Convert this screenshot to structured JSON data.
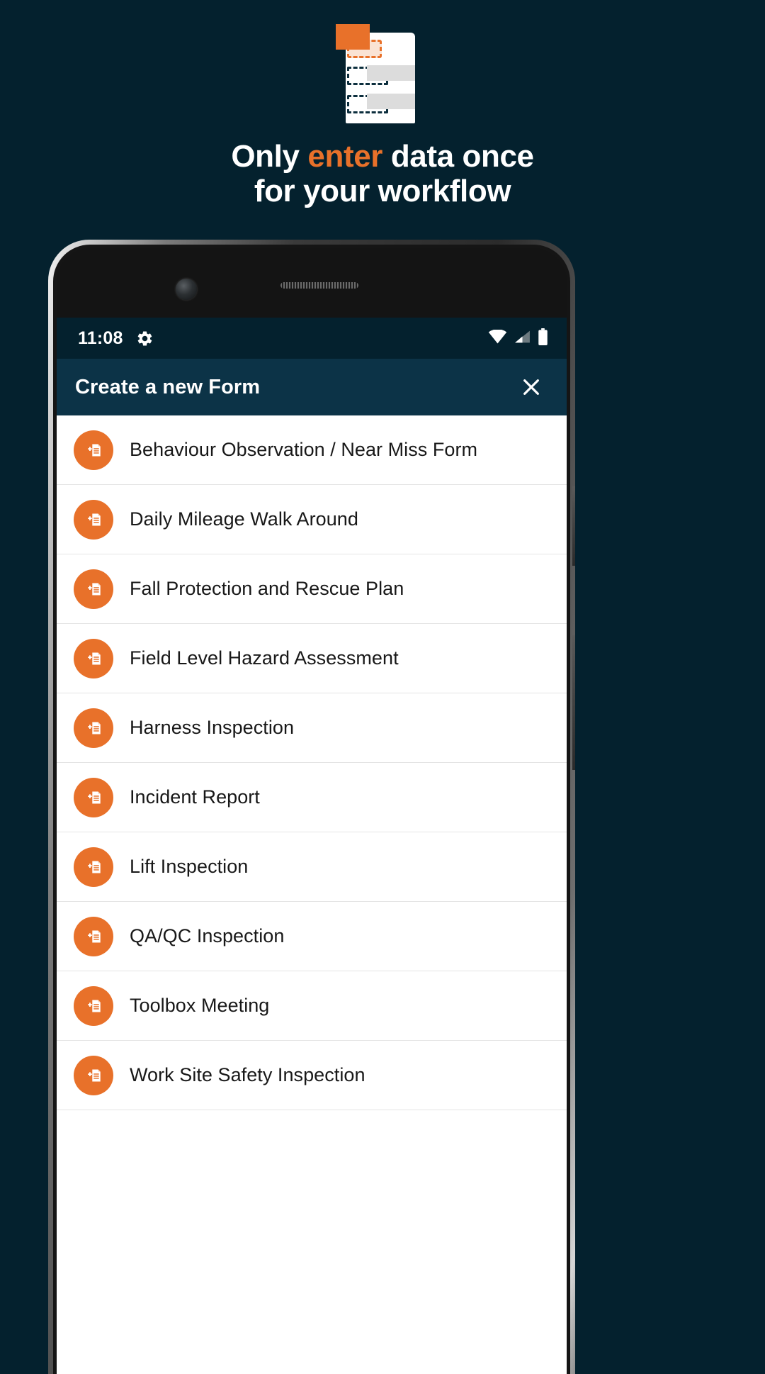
{
  "theme": {
    "background": "#04212e",
    "accent": "#e8712a",
    "header_bar": "#0c3347",
    "text_light": "#ffffff",
    "text_dark": "#181818",
    "divider": "#e4e4e4"
  },
  "illustration": {
    "name": "form-data-entry-illustration",
    "card_color": "#ffffff",
    "block_color": "#e8712a",
    "field_color": "#dcdcdc"
  },
  "headline": {
    "line1_before": "Only ",
    "line1_accent": "enter",
    "line1_after": " data once",
    "line2": "for your workflow"
  },
  "phone": {
    "statusbar": {
      "time": "11:08",
      "gear_icon": "gear-icon",
      "wifi_icon": "wifi-icon",
      "signal_icon": "cell-signal-icon",
      "battery_icon": "battery-full-icon"
    },
    "dialog": {
      "title": "Create a new Form",
      "close_label": "×",
      "close_icon": "close-icon",
      "row_icon": "add-document-icon",
      "items": [
        {
          "label": "Behaviour Observation / Near Miss Form"
        },
        {
          "label": "Daily Mileage Walk Around"
        },
        {
          "label": "Fall Protection and Rescue Plan"
        },
        {
          "label": "Field Level Hazard Assessment"
        },
        {
          "label": "Harness Inspection"
        },
        {
          "label": "Incident Report"
        },
        {
          "label": "Lift Inspection"
        },
        {
          "label": "QA/QC Inspection"
        },
        {
          "label": "Toolbox Meeting"
        },
        {
          "label": "Work Site Safety Inspection"
        }
      ]
    }
  }
}
